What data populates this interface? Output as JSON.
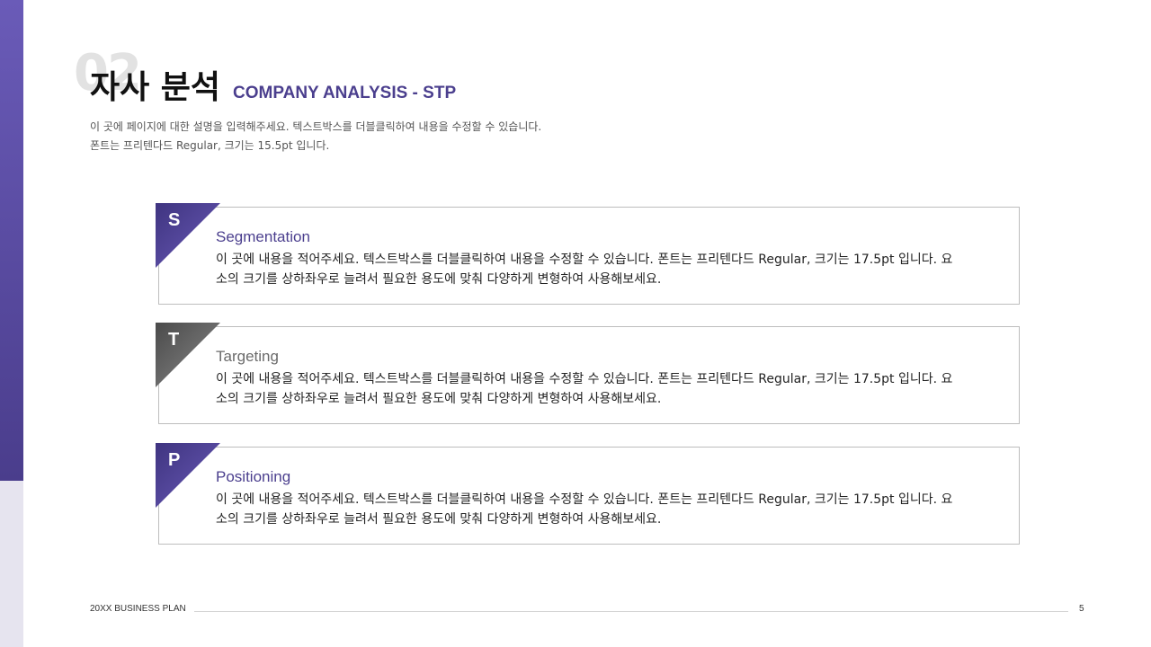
{
  "slide": {
    "section_number": "02",
    "title_ko": "자사 분석",
    "title_en": "COMPANY ANALYSIS - STP",
    "description_line1": "이 곳에 페이지에 대한 설명을 입력해주세요. 텍스트박스를 더블클릭하여 내용을 수정할 수 있습니다.",
    "description_line2": "폰트는 프리텐다드 Regular, 크기는 15.5pt 입니다."
  },
  "cards": [
    {
      "letter": "S",
      "title": "Segmentation",
      "color": "#4b3f8e",
      "body_line1": "이 곳에 내용을 적어주세요. 텍스트박스를 더블클릭하여 내용을 수정할 수 있습니다. 폰트는 프리텐다드 Regular, 크기는 17.5pt 입니다. 요",
      "body_line2": "소의 크기를 상하좌우로 늘려서 필요한 용도에 맞춰 다양하게 변형하여 사용해보세요."
    },
    {
      "letter": "T",
      "title": "Targeting",
      "color": "#6b6b6b",
      "body_line1": "이 곳에 내용을 적어주세요. 텍스트박스를 더블클릭하여 내용을 수정할 수 있습니다. 폰트는 프리텐다드 Regular, 크기는 17.5pt 입니다. 요",
      "body_line2": "소의 크기를 상하좌우로 늘려서 필요한 용도에 맞춰 다양하게 변형하여 사용해보세요."
    },
    {
      "letter": "P",
      "title": "Positioning",
      "color": "#4b3f8e",
      "body_line1": "이 곳에 내용을 적어주세요. 텍스트박스를 더블클릭하여 내용을 수정할 수 있습니다. 폰트는 프리텐다드 Regular, 크기는 17.5pt 입니다. 요",
      "body_line2": "소의 크기를 상하좌우로 늘려서 필요한 용도에 맞춰 다양하게 변형하여 사용해보세요."
    }
  ],
  "footer": {
    "label": "20XX BUSINESS PLAN",
    "page_number": "5"
  },
  "colors": {
    "accent": "#4b3f8e",
    "accent_light": "#6a5bb8",
    "neutral": "#6b6b6b",
    "sidebar_light": "#e6e4ef"
  }
}
